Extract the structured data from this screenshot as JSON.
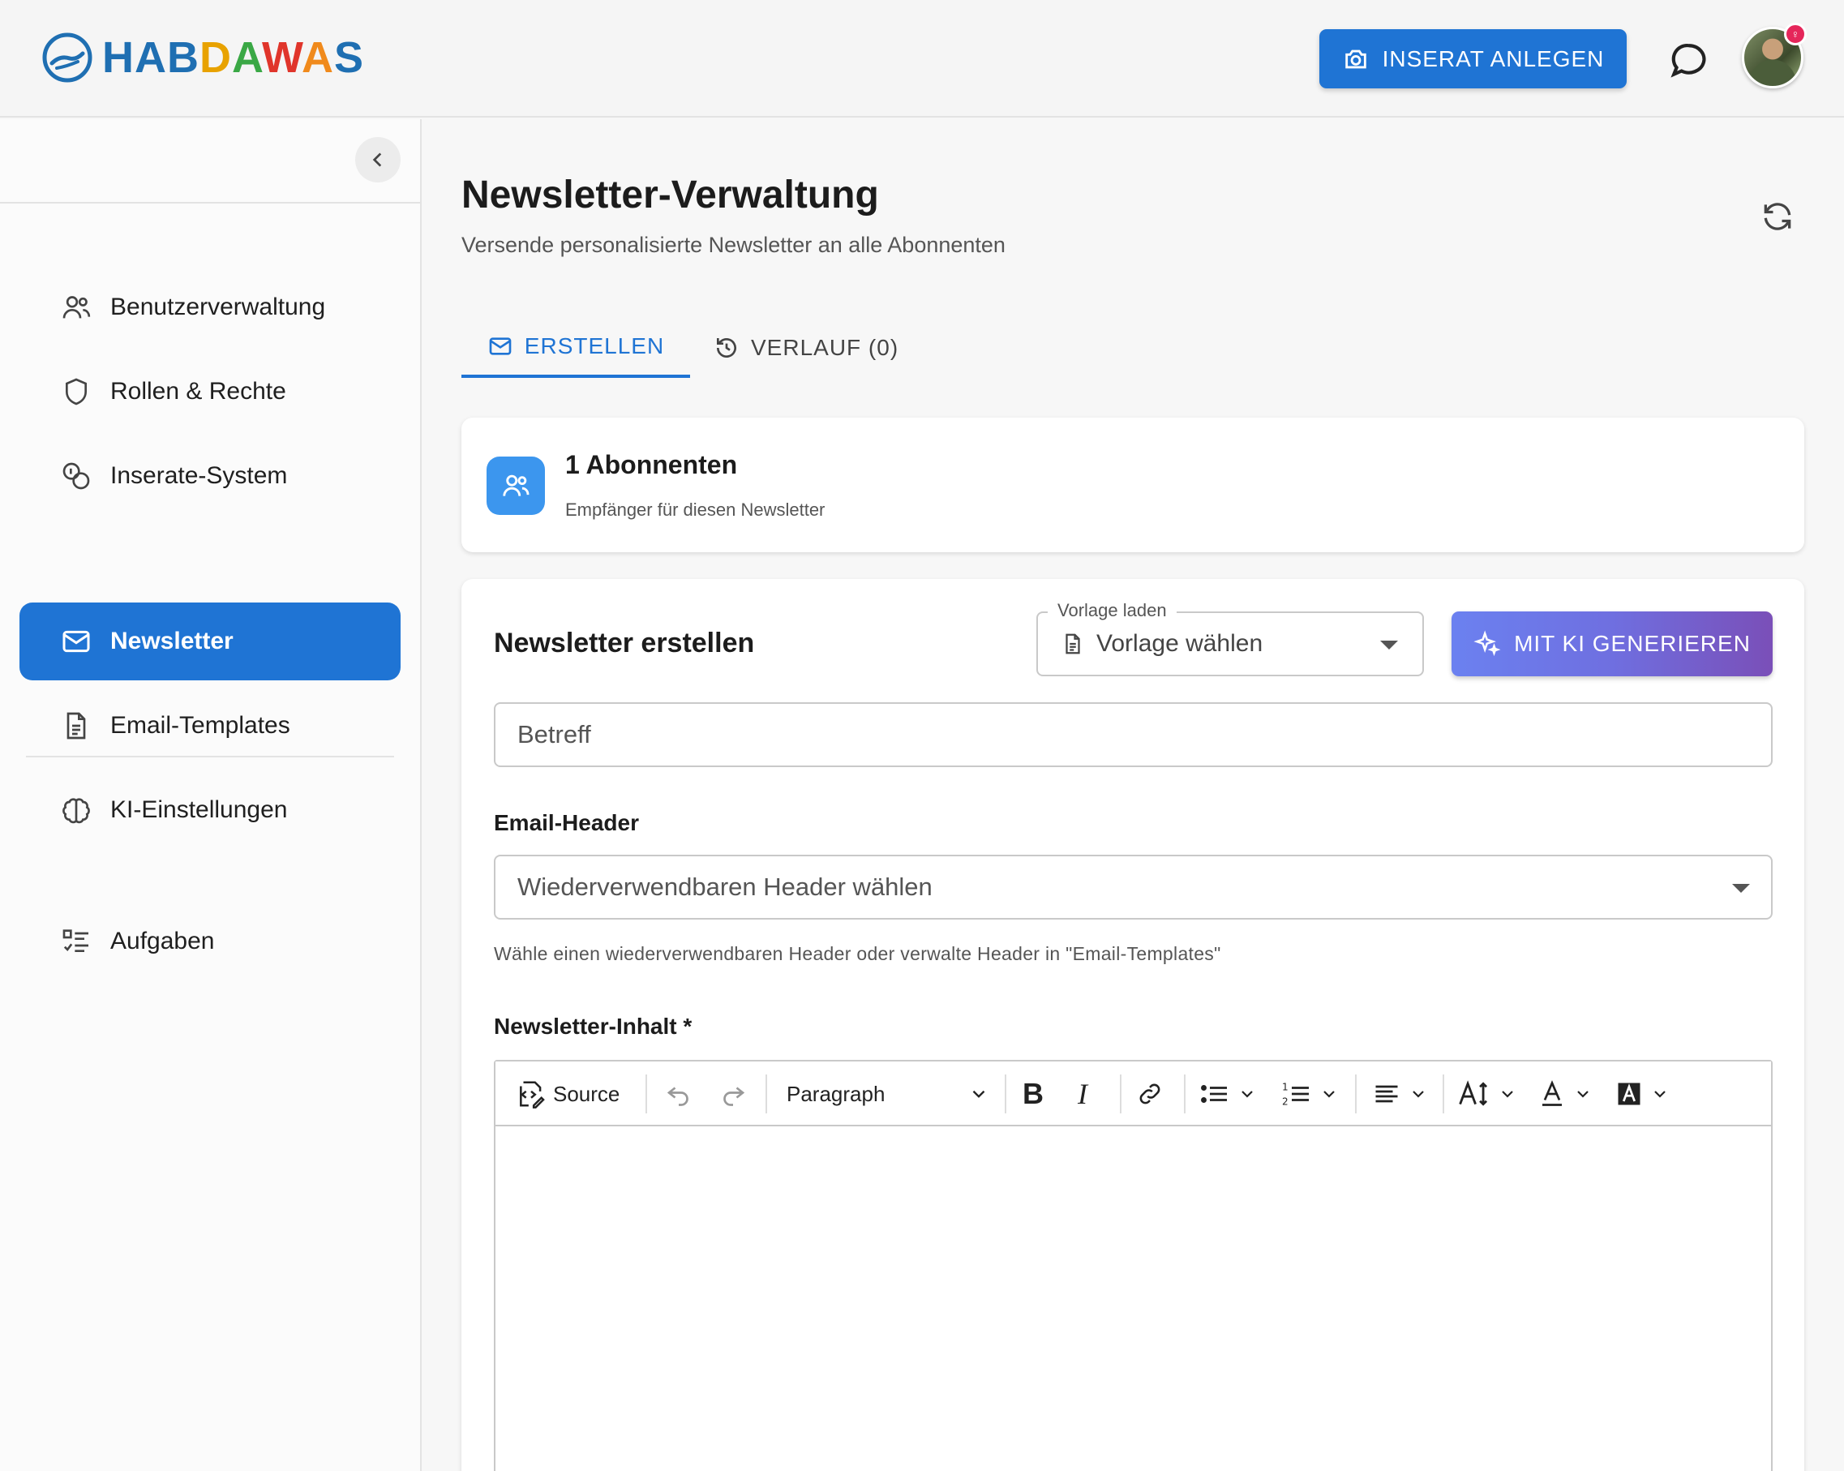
{
  "header": {
    "logo_text": "HABDAWAS",
    "create_button": "INSERAT ANLEGEN",
    "colors": {
      "primary": "#1f74d4",
      "badge": "#e5265a"
    }
  },
  "sidebar": {
    "items": [
      {
        "label": "Benutzerverwaltung",
        "icon": "users-icon"
      },
      {
        "label": "Rollen & Rechte",
        "icon": "shield-icon"
      },
      {
        "label": "Inserate-System",
        "icon": "coins-icon"
      },
      {
        "label": "Newsletter",
        "icon": "mail-icon",
        "active": true
      },
      {
        "label": "Email-Templates",
        "icon": "document-icon"
      },
      {
        "label": "KI-Einstellungen",
        "icon": "brain-icon"
      },
      {
        "label": "Aufgaben",
        "icon": "task-list-icon"
      }
    ]
  },
  "main": {
    "title": "Newsletter-Verwaltung",
    "subtitle": "Versende personalisierte Newsletter an alle Abonnenten",
    "tabs": [
      {
        "label": "ERSTELLEN",
        "active": true
      },
      {
        "label": "VERLAUF (0)",
        "active": false
      }
    ],
    "subscribers": {
      "count_label": "1 Abonnenten",
      "description": "Empfänger für diesen Newsletter"
    },
    "form": {
      "title": "Newsletter erstellen",
      "template_label": "Vorlage laden",
      "template_value": "Vorlage wählen",
      "ai_button": "MIT KI GENERIEREN",
      "subject_placeholder": "Betreff",
      "header_label": "Email-Header",
      "header_value": "Wiederverwendbaren Header wählen",
      "header_help": "Wähle einen wiederverwendbaren Header oder verwalte Header in \"Email-Templates\"",
      "content_label": "Newsletter-Inhalt *",
      "toolbar": {
        "source": "Source",
        "paragraph": "Paragraph"
      }
    }
  }
}
